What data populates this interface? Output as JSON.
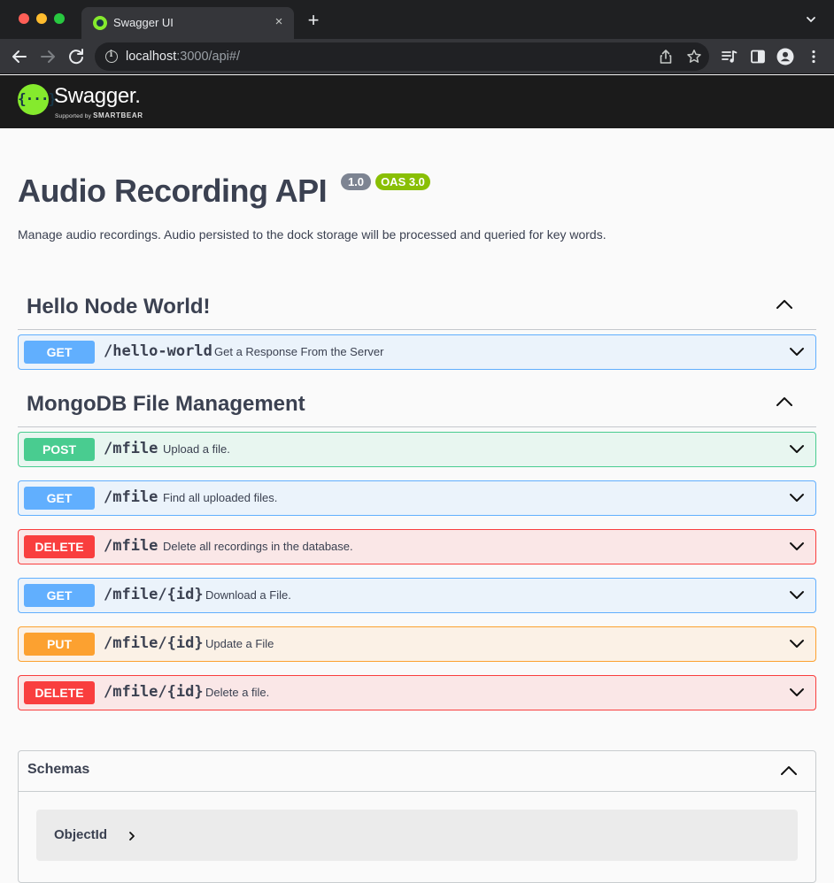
{
  "browser": {
    "tab_title": "Swagger UI",
    "tab_close": "×",
    "new_tab": "+",
    "url_host": "localhost",
    "url_rest": ":3000/api#/"
  },
  "swagger": {
    "logo_mark": "{···}",
    "logo_word": "Swagger.",
    "logo_sub_prefix": "Supported by",
    "logo_sub_brand": "SMARTBEAR"
  },
  "api": {
    "title": "Audio Recording API",
    "version": "1.0",
    "oas": "OAS 3.0",
    "description": "Manage audio recordings. Audio persisted to the dock storage will be processed and queried for key words."
  },
  "tags": [
    {
      "name": "Hello Node World!",
      "operations": [
        {
          "method": "GET",
          "path": "/hello-world",
          "summary": "Get a Response From the Server"
        }
      ]
    },
    {
      "name": "MongoDB File Management",
      "operations": [
        {
          "method": "POST",
          "path": "/mfile",
          "summary": "Upload a file."
        },
        {
          "method": "GET",
          "path": "/mfile",
          "summary": "Find all uploaded files."
        },
        {
          "method": "DELETE",
          "path": "/mfile",
          "summary": "Delete all recordings in the database."
        },
        {
          "method": "GET",
          "path": "/mfile/{id}",
          "summary": "Download a File."
        },
        {
          "method": "PUT",
          "path": "/mfile/{id}",
          "summary": "Update a File"
        },
        {
          "method": "DELETE",
          "path": "/mfile/{id}",
          "summary": "Delete a file."
        }
      ]
    }
  ],
  "schemas": {
    "title": "Schemas",
    "models": [
      "ObjectId"
    ]
  },
  "colors": {
    "get": "#61affe",
    "post": "#49cc90",
    "delete": "#f93e3e",
    "put": "#fca130",
    "swagger_green": "#85ea2d"
  },
  "icons": {
    "back": "arrow-left-icon",
    "forward": "arrow-right-icon",
    "reload": "reload-icon",
    "info": "info-icon",
    "share": "share-icon",
    "bookmark": "star-icon",
    "media": "media-queue-icon",
    "sidepanel": "side-panel-icon",
    "profile": "profile-icon",
    "menu": "kebab-menu-icon",
    "collapse": "chevron-up-icon",
    "expand": "chevron-down-icon",
    "model_expand": "chevron-right-icon"
  }
}
